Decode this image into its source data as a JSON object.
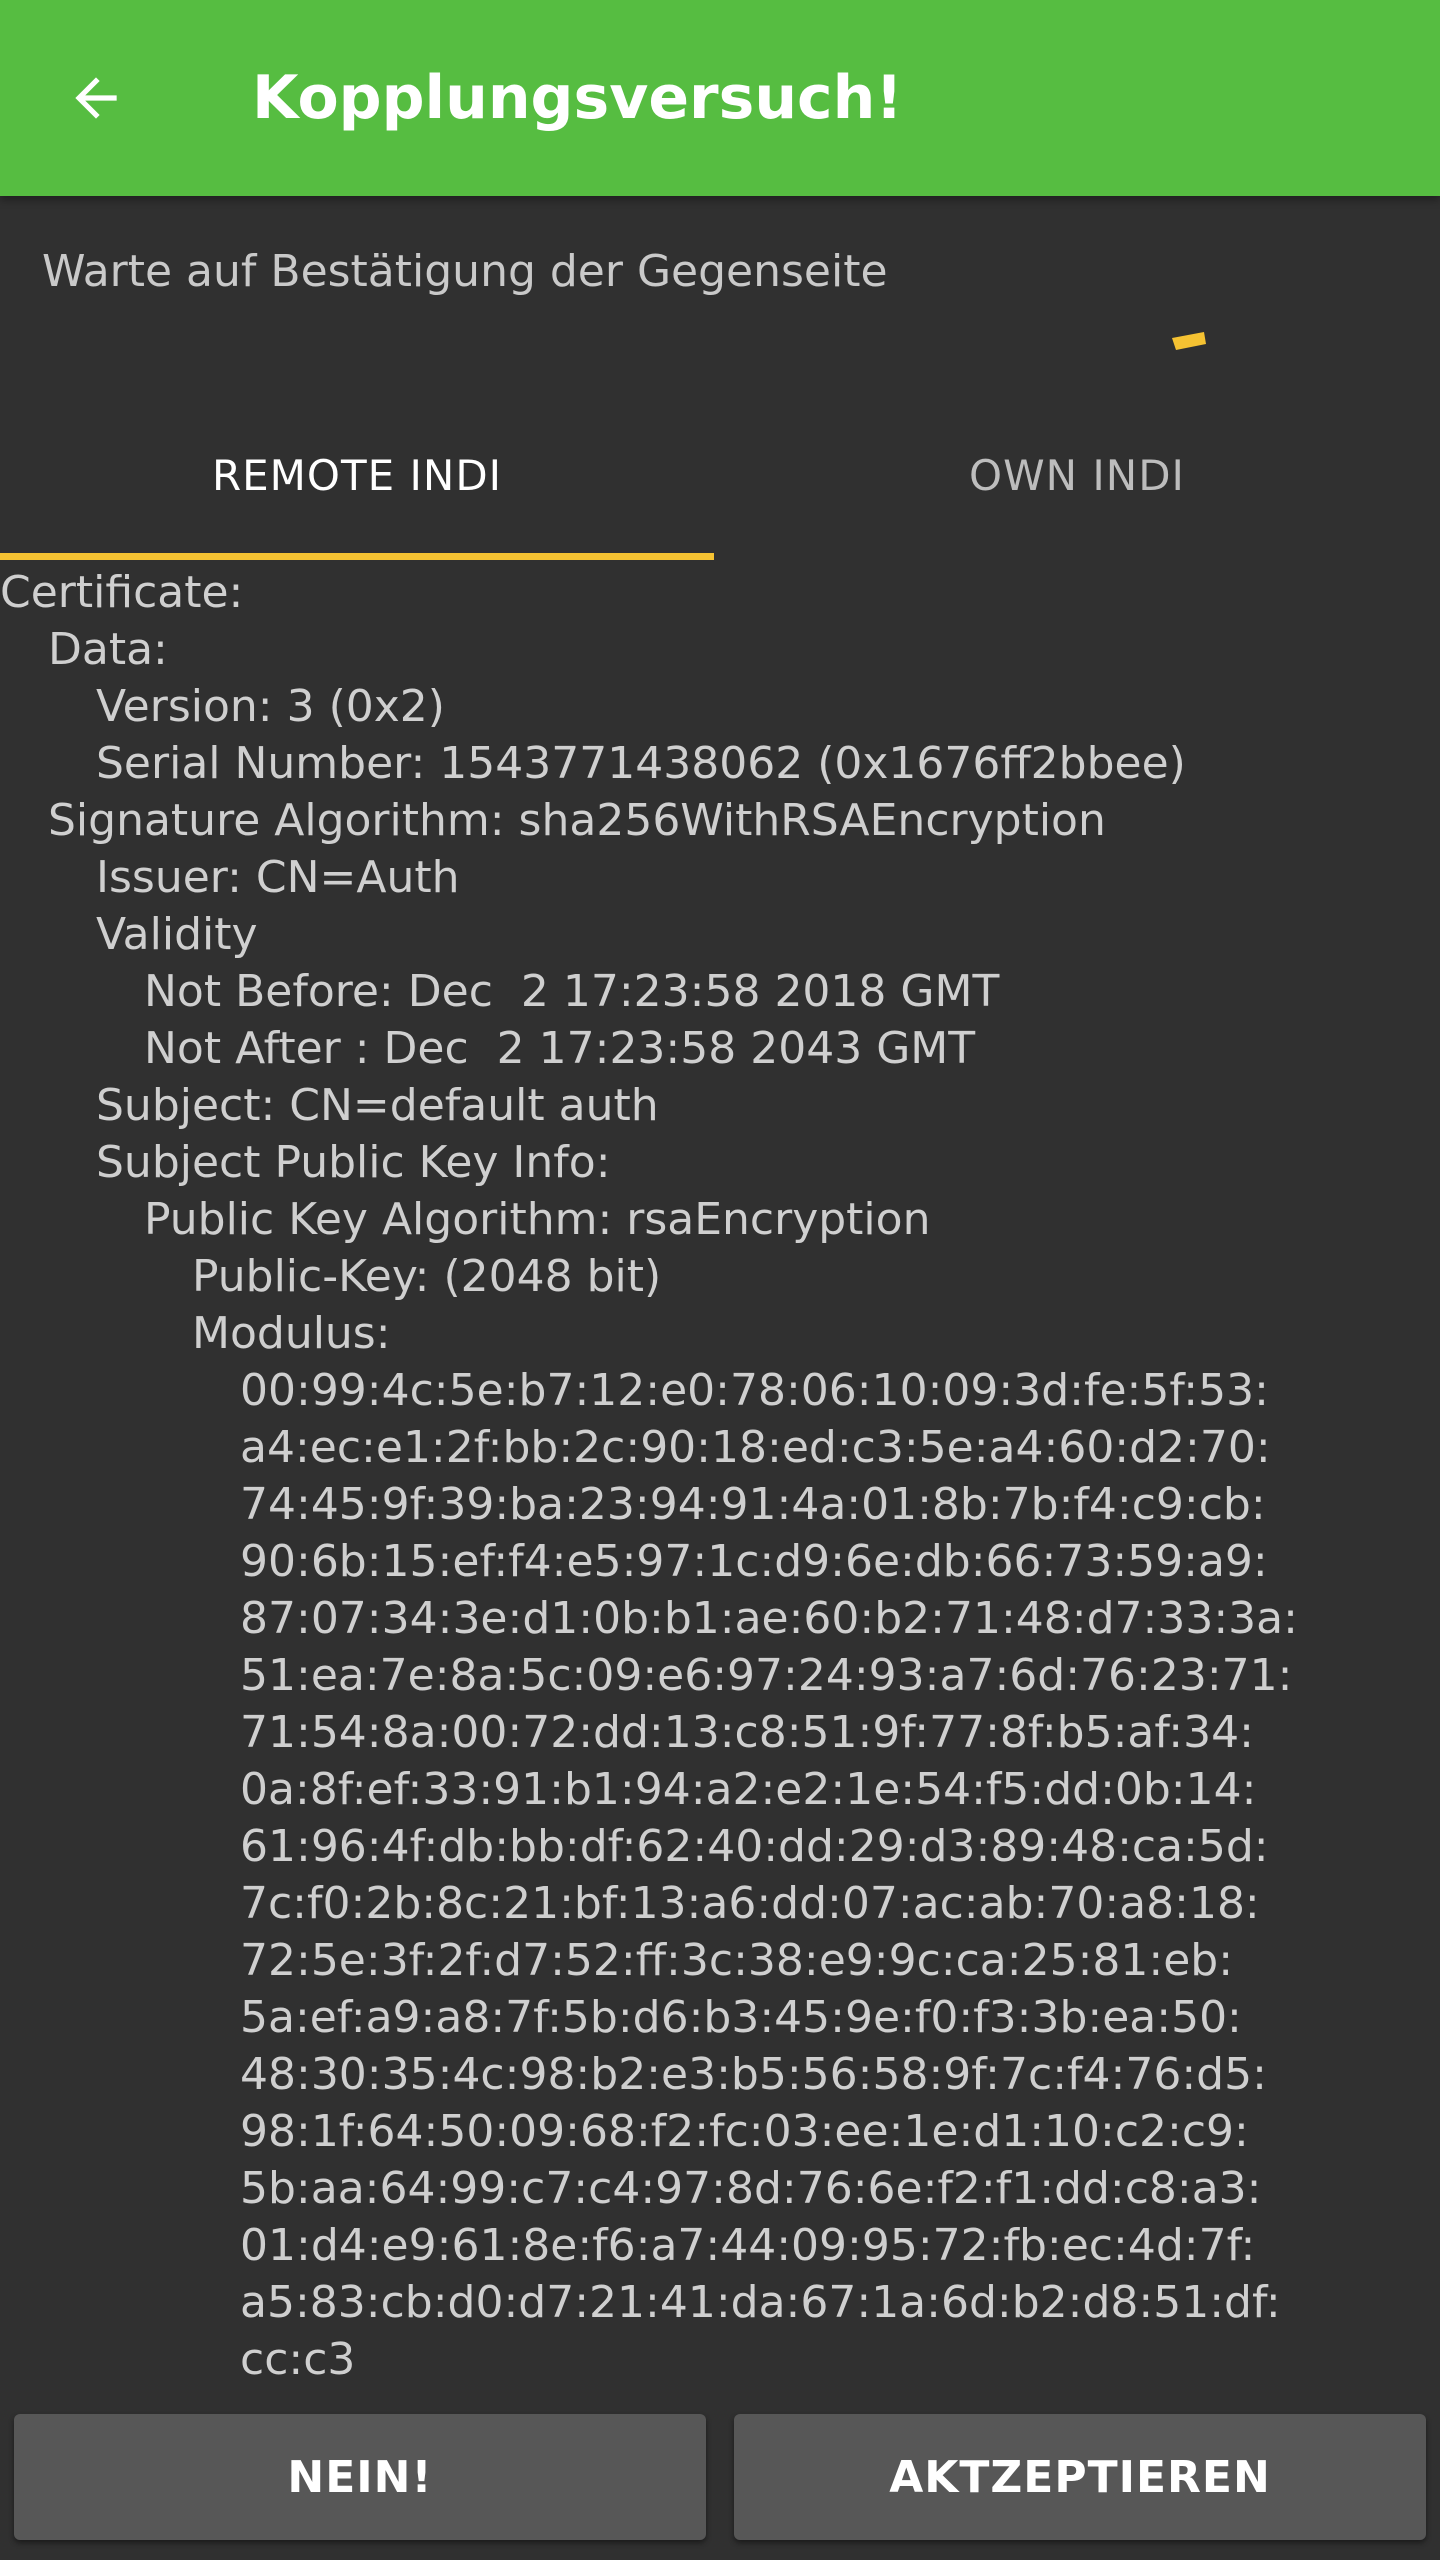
{
  "appbar": {
    "title": "Kopplungsversuch!",
    "back_icon": "arrow-left-icon",
    "color": "#56bd41"
  },
  "status": {
    "text": "Warte auf Bestätigung der Gegenseite",
    "spinner_color": "#f5c232"
  },
  "tabs": [
    {
      "label": "REMOTE INDI",
      "selected": true
    },
    {
      "label": "OWN INDI",
      "selected": false
    }
  ],
  "certificate": [
    {
      "indent": 0,
      "text": "Certificate:"
    },
    {
      "indent": 1,
      "text": "Data:"
    },
    {
      "indent": 2,
      "text": "Version: 3 (0x2)"
    },
    {
      "indent": 2,
      "text": "Serial Number: 1543771438062 (0x1676ff2bbee)"
    },
    {
      "indent": 1,
      "text": "Signature Algorithm: sha256WithRSAEncryption"
    },
    {
      "indent": 2,
      "text": "Issuer: CN=Auth"
    },
    {
      "indent": 2,
      "text": "Validity"
    },
    {
      "indent": 3,
      "text": "Not Before: Dec  2 17:23:58 2018 GMT"
    },
    {
      "indent": 3,
      "text": "Not After : Dec  2 17:23:58 2043 GMT"
    },
    {
      "indent": 2,
      "text": "Subject: CN=default auth"
    },
    {
      "indent": 2,
      "text": "Subject Public Key Info:"
    },
    {
      "indent": 3,
      "text": "Public Key Algorithm: rsaEncryption"
    },
    {
      "indent": 4,
      "text": "Public-Key: (2048 bit)"
    },
    {
      "indent": 4,
      "text": "Modulus:"
    },
    {
      "indent": 5,
      "text": "00:99:4c:5e:b7:12:e0:78:06:10:09:3d:fe:5f:53:"
    },
    {
      "indent": 5,
      "text": "a4:ec:e1:2f:bb:2c:90:18:ed:c3:5e:a4:60:d2:70:"
    },
    {
      "indent": 5,
      "text": "74:45:9f:39:ba:23:94:91:4a:01:8b:7b:f4:c9:cb:"
    },
    {
      "indent": 5,
      "text": "90:6b:15:ef:f4:e5:97:1c:d9:6e:db:66:73:59:a9:"
    },
    {
      "indent": 5,
      "text": "87:07:34:3e:d1:0b:b1:ae:60:b2:71:48:d7:33:3a:"
    },
    {
      "indent": 5,
      "text": "51:ea:7e:8a:5c:09:e6:97:24:93:a7:6d:76:23:71:"
    },
    {
      "indent": 5,
      "text": "71:54:8a:00:72:dd:13:c8:51:9f:77:8f:b5:af:34:"
    },
    {
      "indent": 5,
      "text": "0a:8f:ef:33:91:b1:94:a2:e2:1e:54:f5:dd:0b:14:"
    },
    {
      "indent": 5,
      "text": "61:96:4f:db:bb:df:62:40:dd:29:d3:89:48:ca:5d:"
    },
    {
      "indent": 5,
      "text": "7c:f0:2b:8c:21:bf:13:a6:dd:07:ac:ab:70:a8:18:"
    },
    {
      "indent": 5,
      "text": "72:5e:3f:2f:d7:52:ff:3c:38:e9:9c:ca:25:81:eb:"
    },
    {
      "indent": 5,
      "text": "5a:ef:a9:a8:7f:5b:d6:b3:45:9e:f0:f3:3b:ea:50:"
    },
    {
      "indent": 5,
      "text": "48:30:35:4c:98:b2:e3:b5:56:58:9f:7c:f4:76:d5:"
    },
    {
      "indent": 5,
      "text": "98:1f:64:50:09:68:f2:fc:03:ee:1e:d1:10:c2:c9:"
    },
    {
      "indent": 5,
      "text": "5b:aa:64:99:c7:c4:97:8d:76:6e:f2:f1:dd:c8:a3:"
    },
    {
      "indent": 5,
      "text": "01:d4:e9:61:8e:f6:a7:44:09:95:72:fb:ec:4d:7f:"
    },
    {
      "indent": 5,
      "text": "a5:83:cb:d0:d7:21:41:da:67:1a:6d:b2:d8:51:df:"
    },
    {
      "indent": 5,
      "text": "cc:c3"
    }
  ],
  "buttons": {
    "reject_label": "NEIN!",
    "accept_label": "AKTZEPTIEREN"
  }
}
